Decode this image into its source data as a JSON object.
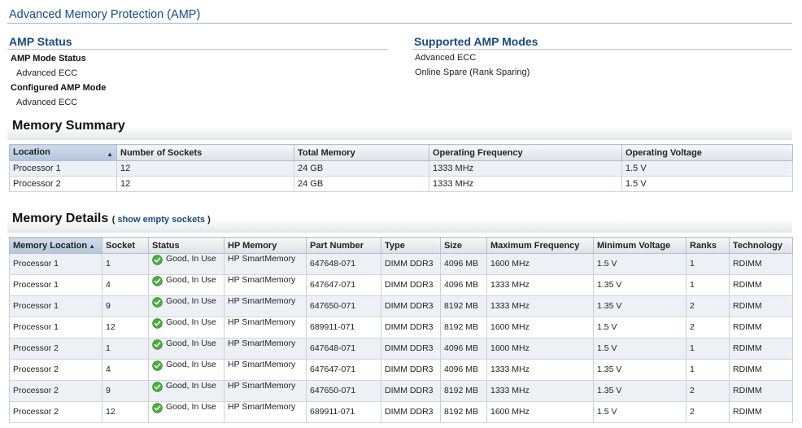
{
  "page_title": "Advanced Memory Protection (AMP)",
  "amp_status": {
    "heading": "AMP Status",
    "mode_status_label": "AMP Mode Status",
    "mode_status_value": "Advanced ECC",
    "configured_label": "Configured AMP Mode",
    "configured_value": "Advanced ECC"
  },
  "supported_modes": {
    "heading": "Supported AMP Modes",
    "items": [
      "Advanced ECC",
      "Online Spare (Rank Sparing)"
    ]
  },
  "memory_summary": {
    "heading": "Memory Summary",
    "columns": [
      "Location",
      "Number of Sockets",
      "Total Memory",
      "Operating Frequency",
      "Operating Voltage"
    ],
    "rows": [
      [
        "Processor 1",
        "12",
        "24 GB",
        "1333 MHz",
        "1.5 V"
      ],
      [
        "Processor 2",
        "12",
        "24 GB",
        "1333 MHz",
        "1.5 V"
      ]
    ]
  },
  "memory_details": {
    "heading": "Memory Details",
    "paren_open": "(",
    "show_empty_link": "show empty sockets",
    "paren_close": ")",
    "columns": [
      "Memory Location",
      "Socket",
      "Status",
      "HP Memory",
      "Part Number",
      "Type",
      "Size",
      "Maximum Frequency",
      "Minimum Voltage",
      "Ranks",
      "Technology"
    ],
    "rows": [
      [
        "Processor 1",
        "1",
        "Good, In Use",
        "HP SmartMemory",
        "647648-071",
        "DIMM DDR3",
        "4096 MB",
        "1600 MHz",
        "1.5 V",
        "1",
        "RDIMM"
      ],
      [
        "Processor 1",
        "4",
        "Good, In Use",
        "HP SmartMemory",
        "647647-071",
        "DIMM DDR3",
        "4096 MB",
        "1333 MHz",
        "1.35 V",
        "1",
        "RDIMM"
      ],
      [
        "Processor 1",
        "9",
        "Good, In Use",
        "HP SmartMemory",
        "647650-071",
        "DIMM DDR3",
        "8192 MB",
        "1333 MHz",
        "1.35 V",
        "2",
        "RDIMM"
      ],
      [
        "Processor 1",
        "12",
        "Good, In Use",
        "HP SmartMemory",
        "689911-071",
        "DIMM DDR3",
        "8192 MB",
        "1600 MHz",
        "1.5 V",
        "2",
        "RDIMM"
      ],
      [
        "Processor 2",
        "1",
        "Good, In Use",
        "HP SmartMemory",
        "647648-071",
        "DIMM DDR3",
        "4096 MB",
        "1600 MHz",
        "1.5 V",
        "1",
        "RDIMM"
      ],
      [
        "Processor 2",
        "4",
        "Good, In Use",
        "HP SmartMemory",
        "647647-071",
        "DIMM DDR3",
        "4096 MB",
        "1333 MHz",
        "1.35 V",
        "1",
        "RDIMM"
      ],
      [
        "Processor 2",
        "9",
        "Good, In Use",
        "HP SmartMemory",
        "647650-071",
        "DIMM DDR3",
        "8192 MB",
        "1333 MHz",
        "1.35 V",
        "2",
        "RDIMM"
      ],
      [
        "Processor 2",
        "12",
        "Good, In Use",
        "HP SmartMemory",
        "689911-071",
        "DIMM DDR3",
        "8192 MB",
        "1600 MHz",
        "1.5 V",
        "2",
        "RDIMM"
      ]
    ]
  },
  "icons": {
    "sort": "sort-ascending-icon",
    "status": "check-circle-icon"
  },
  "colors": {
    "heading_blue": "#1a4a7c",
    "status_green": "#4caf3e"
  }
}
